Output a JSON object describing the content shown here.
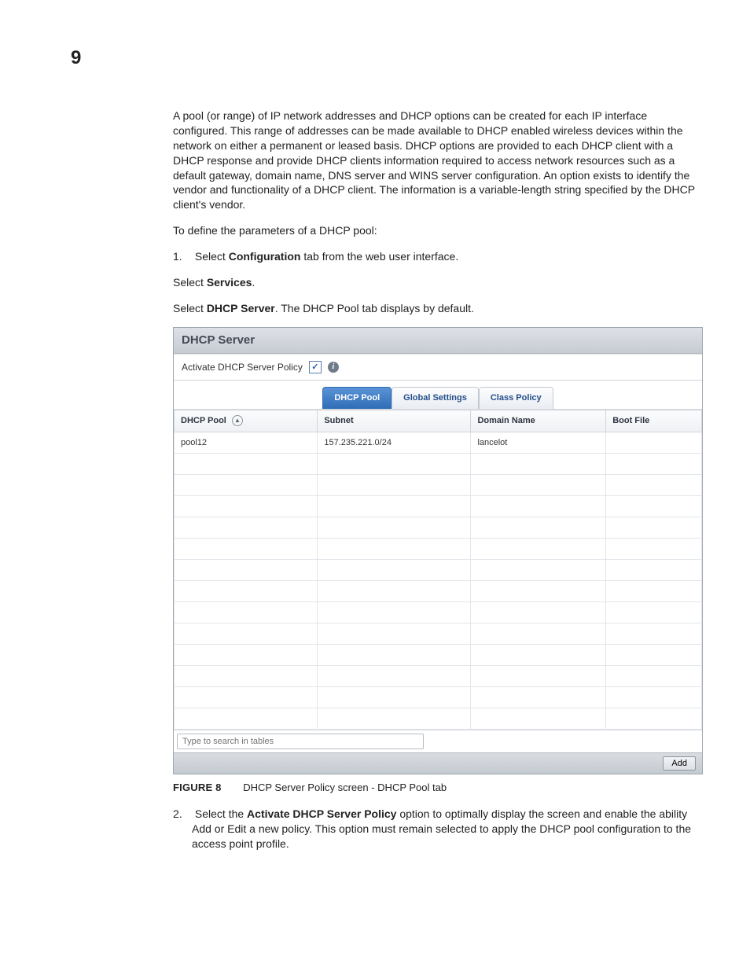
{
  "pageNumber": "9",
  "intro": "A pool (or range) of IP network addresses and DHCP options can be created for each IP interface configured. This range of addresses can be made available to DHCP enabled wireless devices within the network on either a permanent or leased basis. DHCP options are provided to each DHCP client with a DHCP response and provide DHCP clients information required to access network resources such as a default gateway, domain name, DNS server and WINS server configuration. An option exists to identify the vendor and functionality of a DHCP client. The information is a variable-length string specified by the DHCP client's vendor.",
  "defineLine": "To define the parameters of a DHCP pool:",
  "step1": {
    "num": "1.",
    "pre": "Select ",
    "bold": "Configuration",
    "post": " tab from the web user interface."
  },
  "selectServices": {
    "pre": "Select ",
    "bold": "Services",
    "post": "."
  },
  "selectDhcp": {
    "pre": "Select ",
    "bold": "DHCP Server",
    "post": ". The DHCP Pool tab displays by default."
  },
  "panel": {
    "title": "DHCP Server",
    "activateLabel": "Activate DHCP Server Policy",
    "tabs": [
      "DHCP Pool",
      "Global Settings",
      "Class Policy"
    ],
    "headers": [
      "DHCP Pool",
      "Subnet",
      "Domain Name",
      "Boot File"
    ],
    "rows": [
      {
        "pool": "pool12",
        "subnet": "157.235.221.0/24",
        "domain": "lancelot",
        "boot": ""
      }
    ],
    "searchPlaceholder": "Type to search in tables",
    "addLabel": "Add"
  },
  "blankRowCount": 13,
  "figure": {
    "label": "FIGURE 8",
    "caption": "DHCP Server Policy screen - DHCP Pool tab"
  },
  "step2": {
    "num": "2.",
    "pre": "Select the ",
    "bold": "Activate DHCP Server Policy",
    "post": " option to optimally display the screen and enable the ability Add or Edit a new policy. This option must remain selected to apply the DHCP pool configuration to the access point profile."
  }
}
